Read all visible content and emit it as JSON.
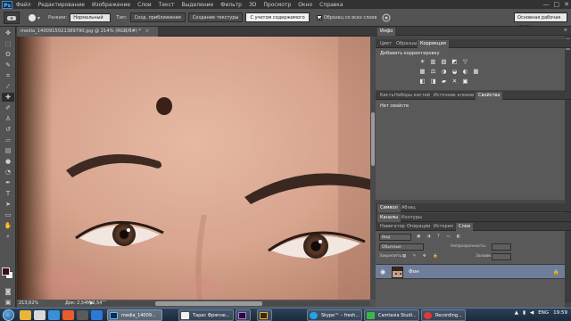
{
  "menubar": {
    "logo": "Ps",
    "items": [
      "Файл",
      "Редактирование",
      "Изображение",
      "Слои",
      "Текст",
      "Выделение",
      "Фильтр",
      "3D",
      "Просмотр",
      "Окно",
      "Справка"
    ],
    "minimize": "—",
    "maximize": "□",
    "close": "✕"
  },
  "options": {
    "mode_label": "Режим:",
    "mode_value": "Нормальный",
    "type_label": "Тип:",
    "type_buttons": [
      "Созд. приближения",
      "Создание текстуры",
      "С учетом содержимого"
    ],
    "selected_type_index": 2,
    "sample_all_label": "Образец со всех слоев",
    "workspace": "Основная рабочая среда"
  },
  "document": {
    "tab_title": "media_1400915021389790.jpg @ 214% (RGB/8#) *",
    "zoom": "213,62%",
    "doc_info": "Док: 2,54M/2,54M"
  },
  "panels": {
    "top_tabs": [
      "Инфо"
    ],
    "adj_tabs": [
      "Цвет",
      "Образцы",
      "Коррекция"
    ],
    "adj_title": "Добавить корректировку",
    "adj_icons_row1": [
      "☀",
      "▥",
      "▨",
      "◩",
      "▽"
    ],
    "adj_icons_row2": [
      "▦",
      "⚖",
      "◑",
      "◒",
      "◐",
      "▦",
      "▤"
    ],
    "adj_icons_row3": [
      "◧",
      "◨",
      "▰",
      "✕",
      "▣"
    ],
    "props_tabs": [
      "Кисть",
      "Наборы кистей",
      "Источник клонов",
      "Свойства"
    ],
    "props_title": "Нет свойств",
    "mini_tabs": [
      "Символ",
      "Абзац"
    ],
    "layers_tabs_1": [
      "Каналы",
      "Контуры"
    ],
    "layers_tabs_2": [
      "Навигатор",
      "Операции",
      "История",
      "Слои"
    ],
    "kind_label": "Вид",
    "blend_mode": "Обычные",
    "opacity_label": "Непрозрачность:",
    "lock_label": "Закрепить:",
    "fill_label": "Заливка:",
    "layer_name": "Фон",
    "layer_lock": "🔒"
  },
  "taskbar": {
    "buttons": [
      "media_14009...",
      "Тарас Фряпне...",
      "",
      "",
      "Skype™ – fresh...",
      "Camtasia Studi...",
      "Recording..."
    ],
    "lang": "ENG",
    "time": "19:59"
  },
  "colors": {
    "accent": "#6f7d99",
    "foreground": "#3a0d10",
    "background": "#f2f2f2"
  }
}
